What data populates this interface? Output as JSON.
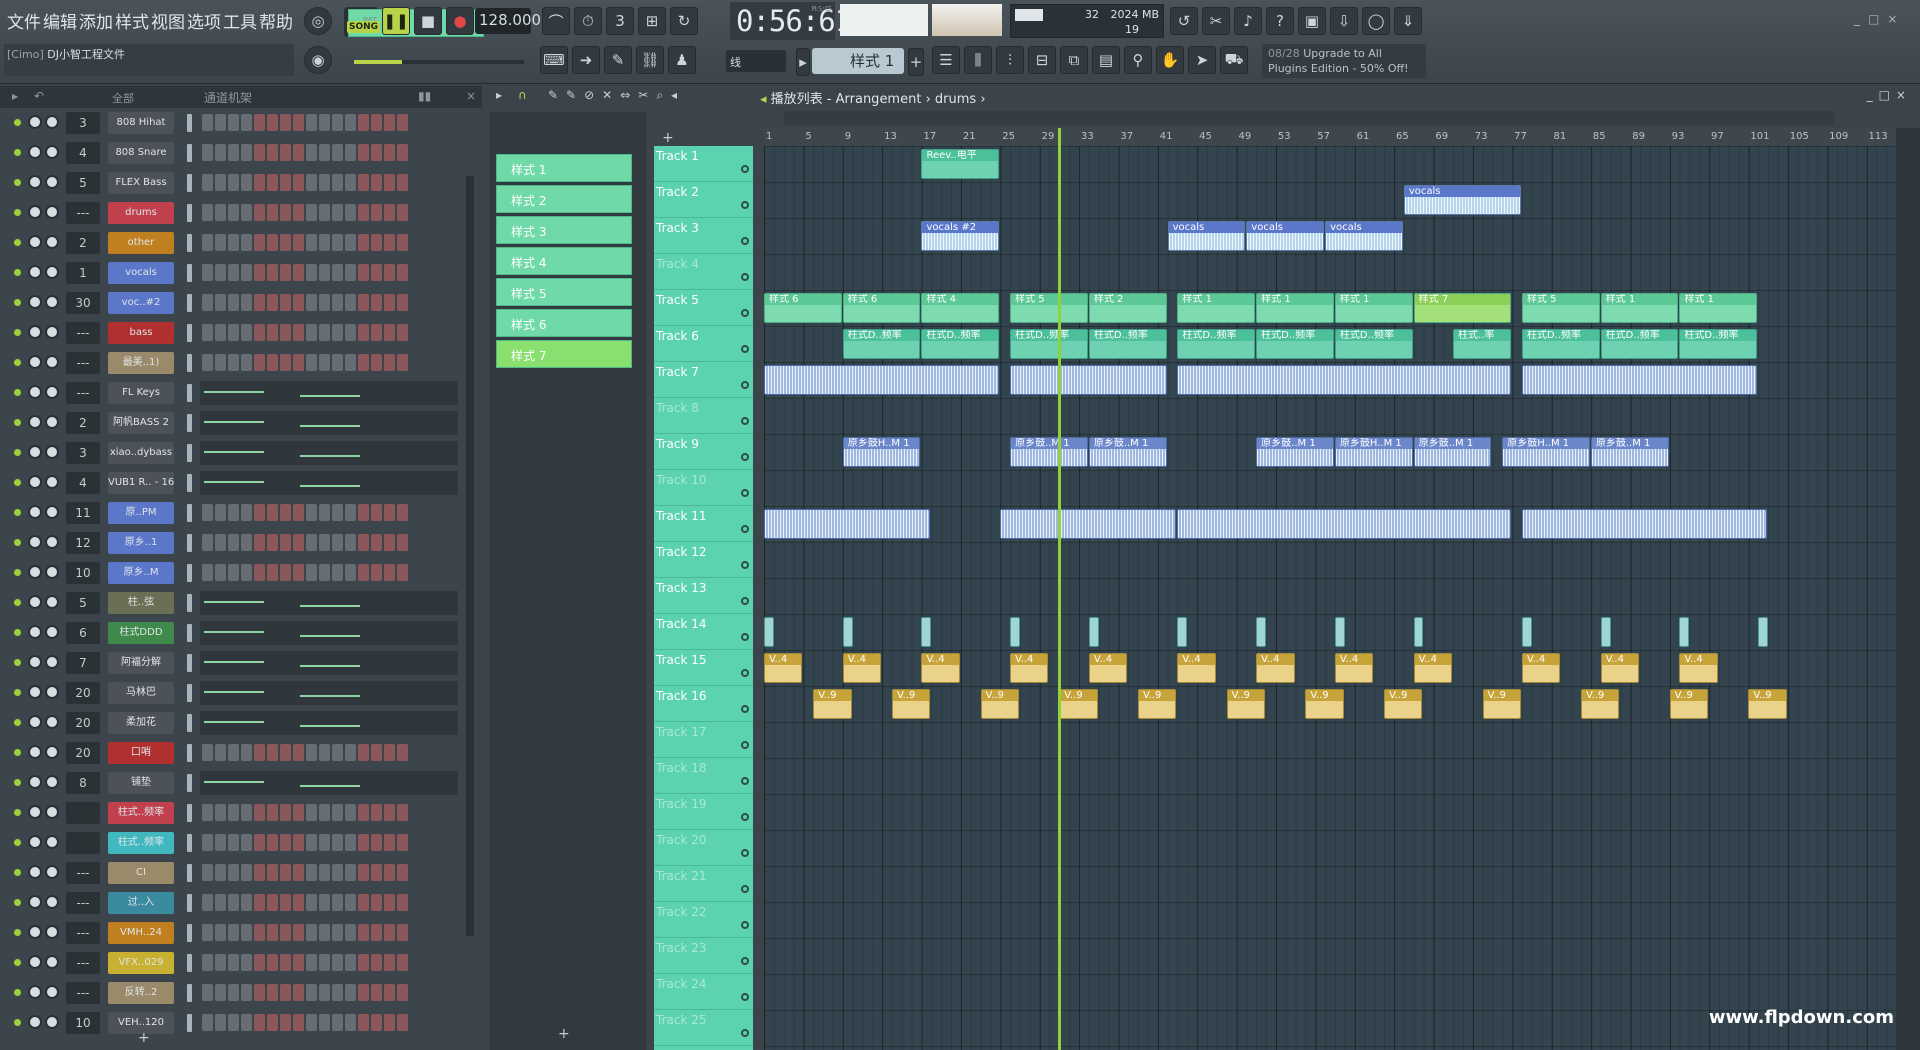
{
  "menu": [
    "文件",
    "编辑",
    "添加",
    "样式",
    "视图",
    "选项",
    "工具",
    "帮助"
  ],
  "transport": {
    "pat_label": "PAT",
    "song_label": "SONG",
    "tempo": "128.000",
    "time": "0:56:61",
    "time_unit": "M:S:CS"
  },
  "cpu": {
    "voices": "32",
    "memory": "2024 MB",
    "polyphony": "19"
  },
  "project": {
    "cimo": "[Cimo]",
    "name": "DJ小智工程文件"
  },
  "pattern_selector": "样式 1",
  "snap": "线",
  "promo": {
    "count": "08/28",
    "line1": "Upgrade to All",
    "line2": "Plugins Edition - 50% Off!"
  },
  "rack": {
    "filter": "全部",
    "title": "通道机架"
  },
  "channels": [
    {
      "num": "3",
      "name": "808 Hihat",
      "color": "#4c5257",
      "kind": "steps"
    },
    {
      "num": "4",
      "name": "808 Snare",
      "color": "#4c5257",
      "kind": "steps"
    },
    {
      "num": "5",
      "name": "FLEX Bass",
      "color": "#4c5257",
      "kind": "steps"
    },
    {
      "num": "---",
      "name": "drums",
      "color": "#c0404e",
      "kind": "steps"
    },
    {
      "num": "2",
      "name": "other",
      "color": "#c08020",
      "kind": "steps"
    },
    {
      "num": "1",
      "name": "vocals",
      "color": "#5b77c9",
      "kind": "steps"
    },
    {
      "num": "30",
      "name": "voc..#2",
      "color": "#5b77c9",
      "kind": "steps"
    },
    {
      "num": "---",
      "name": "bass",
      "color": "#b03030",
      "kind": "steps"
    },
    {
      "num": "---",
      "name": "最美..1)",
      "color": "#9b8a6a",
      "kind": "steps"
    },
    {
      "num": "---",
      "name": "FL Keys",
      "color": "#4c5257",
      "kind": "roll"
    },
    {
      "num": "2",
      "name": "阿帆BASS 2",
      "color": "#4c5257",
      "kind": "roll"
    },
    {
      "num": "3",
      "name": "xiao..dybass",
      "color": "#4c5257",
      "kind": "roll"
    },
    {
      "num": "4",
      "name": "VUB1 R.. - 16",
      "color": "#4c5257",
      "kind": "roll"
    },
    {
      "num": "11",
      "name": "原..PM",
      "color": "#5b77c9",
      "kind": "steps"
    },
    {
      "num": "12",
      "name": "原乡..1",
      "color": "#5b77c9",
      "kind": "steps"
    },
    {
      "num": "10",
      "name": "原乡..M",
      "color": "#5b77c9",
      "kind": "steps"
    },
    {
      "num": "5",
      "name": "柱..弦",
      "color": "#6b6f55",
      "kind": "roll"
    },
    {
      "num": "6",
      "name": "柱式DDD",
      "color": "#3f8a4a",
      "kind": "roll"
    },
    {
      "num": "7",
      "name": "阿福分解",
      "color": "#4c5257",
      "kind": "roll"
    },
    {
      "num": "20",
      "name": "马林巴",
      "color": "#4c5257",
      "kind": "roll"
    },
    {
      "num": "20",
      "name": "柔加花",
      "color": "#4c5257",
      "kind": "roll"
    },
    {
      "num": "20",
      "name": "口哨",
      "color": "#b03030",
      "kind": "steps"
    },
    {
      "num": "8",
      "name": "铺垫",
      "color": "#4c5257",
      "kind": "roll"
    },
    {
      "num": "",
      "name": "柱式..频率",
      "color": "#c0404e",
      "kind": "steps"
    },
    {
      "num": "",
      "name": "柱式..频率",
      "color": "#40b8c0",
      "kind": "steps"
    },
    {
      "num": "---",
      "name": "CI",
      "color": "#9b8a6a",
      "kind": "steps"
    },
    {
      "num": "---",
      "name": "过..入",
      "color": "#3a8aa0",
      "kind": "steps"
    },
    {
      "num": "---",
      "name": "VMH..24",
      "color": "#c08020",
      "kind": "steps"
    },
    {
      "num": "---",
      "name": "VFX..029",
      "color": "#c8b030",
      "kind": "steps"
    },
    {
      "num": "---",
      "name": "反转..2",
      "color": "#9b8a6a",
      "kind": "steps"
    },
    {
      "num": "10",
      "name": "VEH..120",
      "color": "#4c5257",
      "kind": "steps"
    }
  ],
  "patterns": [
    "样式 1",
    "样式 2",
    "样式 3",
    "样式 4",
    "样式 5",
    "样式 6",
    "样式 7"
  ],
  "playlist": {
    "title": "播放列表 - Arrangement",
    "crumb": "drums"
  },
  "ruler": [
    "1",
    "5",
    "9",
    "13",
    "17",
    "21",
    "25",
    "29",
    "33",
    "37",
    "41",
    "45",
    "49",
    "53",
    "57",
    "61",
    "65",
    "69",
    "73",
    "77",
    "81",
    "85",
    "89",
    "93",
    "97",
    "101",
    "105",
    "109",
    "113"
  ],
  "tracks": [
    "Track 1",
    "Track 2",
    "Track 3",
    "Track 4",
    "Track 5",
    "Track 6",
    "Track 7",
    "Track 8",
    "Track 9",
    "Track 10",
    "Track 11",
    "Track 12",
    "Track 13",
    "Track 14",
    "Track 15",
    "Track 16",
    "Track 17",
    "Track 18",
    "Track 19",
    "Track 20",
    "Track 21",
    "Track 22",
    "Track 23",
    "Track 24",
    "Track 25"
  ],
  "clips": [
    {
      "t": 1,
      "b": 17,
      "len": 8,
      "label": "Reev..电平",
      "c": "c-aut"
    },
    {
      "t": 2,
      "b": 66,
      "len": 12,
      "label": "vocals",
      "c": "c-voc"
    },
    {
      "t": 3,
      "b": 17,
      "len": 8,
      "label": "vocals #2",
      "c": "c-voc"
    },
    {
      "t": 3,
      "b": 42,
      "len": 8,
      "label": "vocals",
      "c": "c-voc"
    },
    {
      "t": 3,
      "b": 50,
      "len": 8,
      "label": "vocals",
      "c": "c-voc"
    },
    {
      "t": 3,
      "b": 58,
      "len": 8,
      "label": "vocals",
      "c": "c-voc"
    },
    {
      "t": 5,
      "b": 1,
      "len": 8,
      "label": "样式 6",
      "c": "c-pat"
    },
    {
      "t": 5,
      "b": 9,
      "len": 8,
      "label": "样式 6",
      "c": "c-pat"
    },
    {
      "t": 5,
      "b": 17,
      "len": 8,
      "label": "样式 4",
      "c": "c-pat"
    },
    {
      "t": 5,
      "b": 26,
      "len": 8,
      "label": "样式 5",
      "c": "c-pat"
    },
    {
      "t": 5,
      "b": 34,
      "len": 8,
      "label": "样式 2",
      "c": "c-pat"
    },
    {
      "t": 5,
      "b": 43,
      "len": 8,
      "label": "样式 1",
      "c": "c-pat"
    },
    {
      "t": 5,
      "b": 51,
      "len": 8,
      "label": "样式 1",
      "c": "c-pat"
    },
    {
      "t": 5,
      "b": 59,
      "len": 8,
      "label": "样式 1",
      "c": "c-pat"
    },
    {
      "t": 5,
      "b": 67,
      "len": 10,
      "label": "样式 7",
      "c": "c-pat sel"
    },
    {
      "t": 5,
      "b": 78,
      "len": 8,
      "label": "样式 5",
      "c": "c-pat"
    },
    {
      "t": 5,
      "b": 86,
      "len": 8,
      "label": "样式 1",
      "c": "c-pat"
    },
    {
      "t": 5,
      "b": 94,
      "len": 8,
      "label": "样式 1",
      "c": "c-pat"
    },
    {
      "t": 6,
      "b": 9,
      "len": 8,
      "label": "柱式D..频率",
      "c": "c-aut"
    },
    {
      "t": 6,
      "b": 17,
      "len": 8,
      "label": "柱式D..频率",
      "c": "c-aut"
    },
    {
      "t": 6,
      "b": 26,
      "len": 8,
      "label": "柱式D..频率",
      "c": "c-aut"
    },
    {
      "t": 6,
      "b": 34,
      "len": 8,
      "label": "柱式D..频率",
      "c": "c-aut"
    },
    {
      "t": 6,
      "b": 43,
      "len": 8,
      "label": "柱式D..频率",
      "c": "c-aut"
    },
    {
      "t": 6,
      "b": 51,
      "len": 8,
      "label": "柱式D..频率",
      "c": "c-aut"
    },
    {
      "t": 6,
      "b": 59,
      "len": 8,
      "label": "柱式D..频率",
      "c": "c-aut"
    },
    {
      "t": 6,
      "b": 71,
      "len": 6,
      "label": "柱式..率",
      "c": "c-aut"
    },
    {
      "t": 6,
      "b": 78,
      "len": 8,
      "label": "柱式D..频率",
      "c": "c-aut"
    },
    {
      "t": 6,
      "b": 86,
      "len": 8,
      "label": "柱式D..频率",
      "c": "c-aut"
    },
    {
      "t": 6,
      "b": 94,
      "len": 8,
      "label": "柱式D..频率",
      "c": "c-aut"
    },
    {
      "t": 9,
      "b": 9,
      "len": 8,
      "label": "原乡鼓H..M 1",
      "c": "c-blu"
    },
    {
      "t": 9,
      "b": 26,
      "len": 8,
      "label": "原乡鼓..M 1",
      "c": "c-blu"
    },
    {
      "t": 9,
      "b": 34,
      "len": 8,
      "label": "原乡鼓..M 1",
      "c": "c-blu"
    },
    {
      "t": 9,
      "b": 51,
      "len": 8,
      "label": "原乡鼓..M 1",
      "c": "c-blu"
    },
    {
      "t": 9,
      "b": 59,
      "len": 8,
      "label": "原乡鼓H..M 1",
      "c": "c-blu"
    },
    {
      "t": 9,
      "b": 67,
      "len": 8,
      "label": "原乡鼓..M 1",
      "c": "c-blu"
    },
    {
      "t": 9,
      "b": 76,
      "len": 9,
      "label": "原乡鼓H..M 1",
      "c": "c-blu"
    },
    {
      "t": 9,
      "b": 85,
      "len": 8,
      "label": "原乡鼓..M 1",
      "c": "c-blu"
    },
    {
      "t": 15,
      "b": 1,
      "len": 4,
      "label": "V..4",
      "c": "c-yel"
    },
    {
      "t": 15,
      "b": 9,
      "len": 4,
      "label": "V..4",
      "c": "c-yel"
    },
    {
      "t": 15,
      "b": 17,
      "len": 4,
      "label": "V..4",
      "c": "c-yel"
    },
    {
      "t": 15,
      "b": 26,
      "len": 4,
      "label": "V..4",
      "c": "c-yel"
    },
    {
      "t": 15,
      "b": 34,
      "len": 4,
      "label": "V..4",
      "c": "c-yel"
    },
    {
      "t": 15,
      "b": 43,
      "len": 4,
      "label": "V..4",
      "c": "c-yel"
    },
    {
      "t": 15,
      "b": 51,
      "len": 4,
      "label": "V..4",
      "c": "c-yel"
    },
    {
      "t": 15,
      "b": 59,
      "len": 4,
      "label": "V..4",
      "c": "c-yel"
    },
    {
      "t": 15,
      "b": 67,
      "len": 4,
      "label": "V..4",
      "c": "c-yel"
    },
    {
      "t": 15,
      "b": 78,
      "len": 4,
      "label": "V..4",
      "c": "c-yel"
    },
    {
      "t": 15,
      "b": 86,
      "len": 4,
      "label": "V..4",
      "c": "c-yel"
    },
    {
      "t": 15,
      "b": 94,
      "len": 4,
      "label": "V..4",
      "c": "c-yel"
    },
    {
      "t": 16,
      "b": 6,
      "len": 4,
      "label": "V..9",
      "c": "c-yel"
    },
    {
      "t": 16,
      "b": 14,
      "len": 4,
      "label": "V..9",
      "c": "c-yel"
    },
    {
      "t": 16,
      "b": 23,
      "len": 4,
      "label": "V..9",
      "c": "c-yel"
    },
    {
      "t": 16,
      "b": 31,
      "len": 4,
      "label": "V..9",
      "c": "c-yel"
    },
    {
      "t": 16,
      "b": 39,
      "len": 4,
      "label": "V..9",
      "c": "c-yel"
    },
    {
      "t": 16,
      "b": 48,
      "len": 4,
      "label": "V..9",
      "c": "c-yel"
    },
    {
      "t": 16,
      "b": 56,
      "len": 4,
      "label": "V..9",
      "c": "c-yel"
    },
    {
      "t": 16,
      "b": 64,
      "len": 4,
      "label": "V..9",
      "c": "c-yel"
    },
    {
      "t": 16,
      "b": 74,
      "len": 4,
      "label": "V..9",
      "c": "c-yel"
    },
    {
      "t": 16,
      "b": 84,
      "len": 4,
      "label": "V..9",
      "c": "c-yel"
    },
    {
      "t": 16,
      "b": 93,
      "len": 4,
      "label": "V..9",
      "c": "c-yel"
    },
    {
      "t": 16,
      "b": 101,
      "len": 4,
      "label": "V..9",
      "c": "c-yel"
    }
  ],
  "watermark": "www.flpdown.com"
}
